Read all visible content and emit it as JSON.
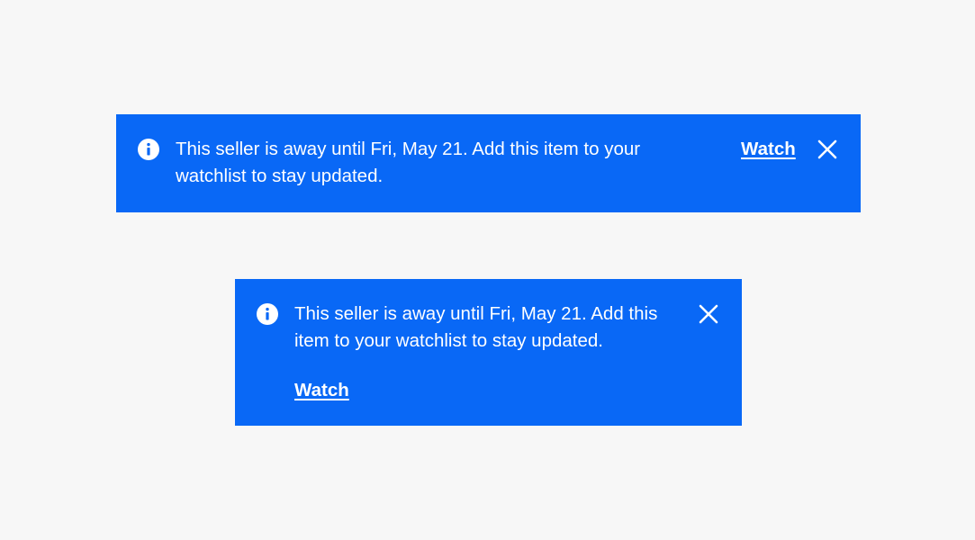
{
  "colors": {
    "page_background": "#f7f7f7",
    "banner_background": "#0968f6",
    "text": "#ffffff"
  },
  "banners": [
    {
      "variant": "wide",
      "icon": "info-icon",
      "message_line1": "This seller is away until Fri, May 21. Add this item to your",
      "message_line2": "watchlist to stay updated.",
      "action_label": "Watch",
      "close_icon": "close-icon"
    },
    {
      "variant": "narrow",
      "icon": "info-icon",
      "message_line1": "This seller is away until Fri, May 21. Add this",
      "message_line2": "item to your watchlist to stay updated.",
      "action_label": "Watch",
      "close_icon": "close-icon"
    }
  ]
}
